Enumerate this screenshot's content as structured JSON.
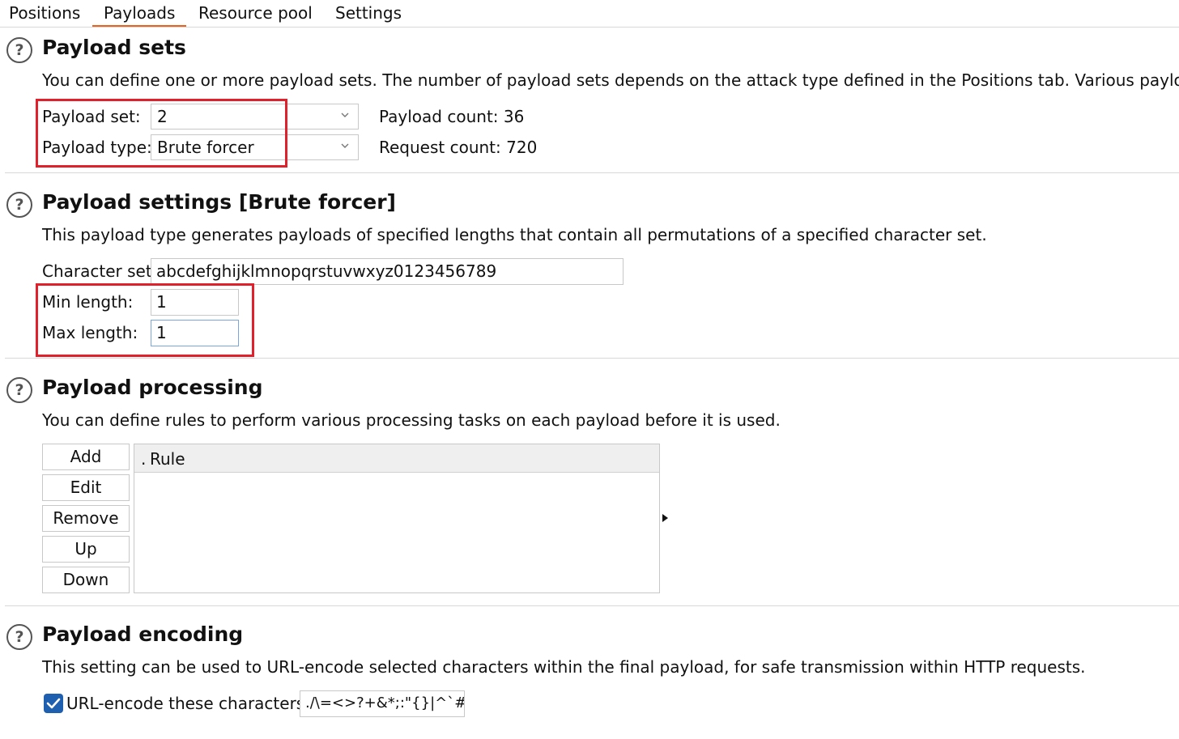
{
  "tabs": [
    {
      "label": "Positions"
    },
    {
      "label": "Payloads"
    },
    {
      "label": "Resource pool"
    },
    {
      "label": "Settings"
    }
  ],
  "help_icon_glyph": "?",
  "payload_sets": {
    "title": "Payload sets",
    "description": "You can define one or more payload sets. The number of payload sets depends on the attack type defined in the Positions tab. Various payload typ",
    "set_label": "Payload set:",
    "set_value": "2",
    "type_label": "Payload type:",
    "type_value": "Brute forcer",
    "payload_count": "Payload count: 36",
    "request_count": "Request count: 720"
  },
  "payload_settings": {
    "title": "Payload settings [Brute forcer]",
    "description": "This payload type generates payloads of specified lengths that contain all permutations of a specified character set.",
    "charset_label": "Character set:",
    "charset_value": "abcdefghijklmnopqrstuvwxyz0123456789",
    "min_label": "Min length:",
    "min_value": "1",
    "max_label": "Max length:",
    "max_value": "1"
  },
  "payload_processing": {
    "title": "Payload processing",
    "description": "You can define rules to perform various processing tasks on each payload before it is used.",
    "buttons": {
      "add": "Add",
      "edit": "Edit",
      "remove": "Remove",
      "up": "Up",
      "down": "Down"
    },
    "table_header_marker": ".",
    "table_header_rule": "Rule"
  },
  "payload_encoding": {
    "title": "Payload encoding",
    "description": "This setting can be used to URL-encode selected characters within the final payload, for safe transmission within HTTP requests.",
    "checkbox_label": "URL-encode these characters:",
    "checked": true,
    "chars_value": "./\\=<>?+&*;:\"{}|^`#"
  },
  "colors": {
    "accent": "#e8631f",
    "highlight_box": "#e0202a",
    "checkbox": "#1f5fb0"
  }
}
